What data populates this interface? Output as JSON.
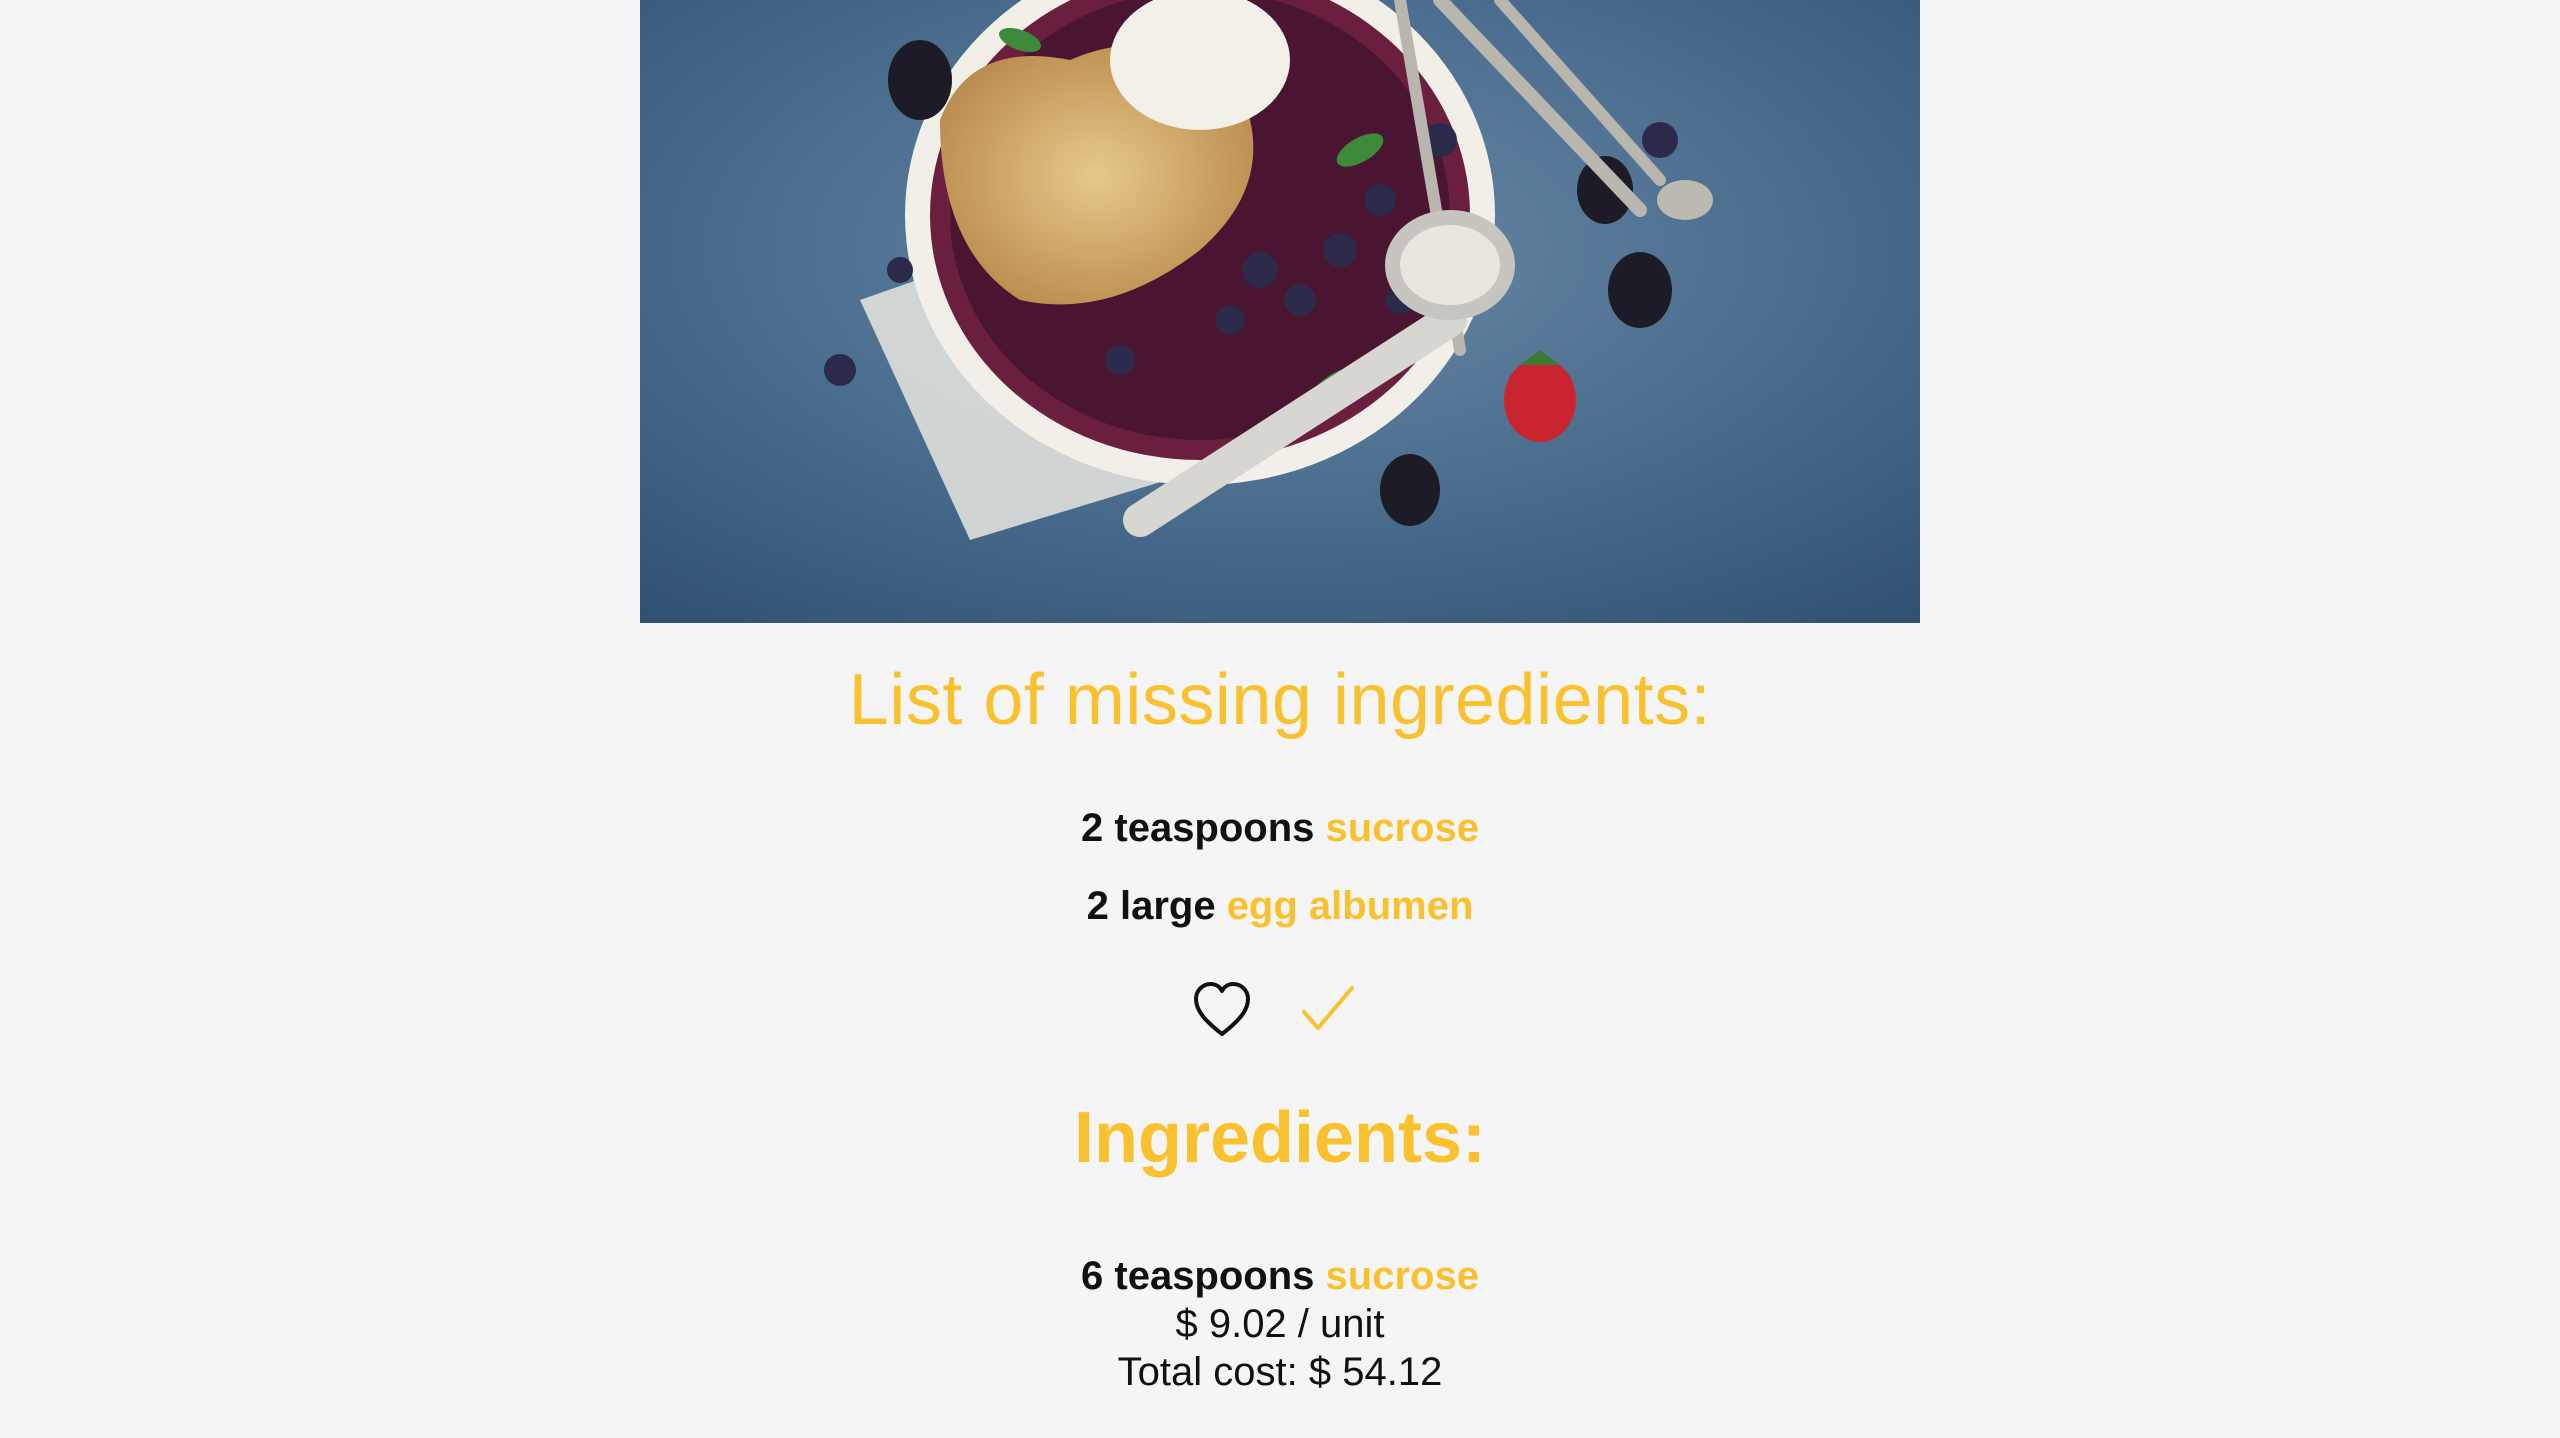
{
  "missing": {
    "title": "List of missing ingredients:",
    "items": [
      {
        "quantity": "2 teaspoons",
        "name": "sucrose"
      },
      {
        "quantity": "2 large",
        "name": "egg albumen"
      }
    ]
  },
  "actions": {
    "favorite_icon": "heart-icon",
    "confirm_icon": "checkmark-icon"
  },
  "ingredients": {
    "title": "Ingredients:",
    "items": [
      {
        "quantity": "6 teaspoons",
        "name": "sucrose",
        "unit_price": "$ 9.02 / unit",
        "total_cost": "Total cost: $ 54.12"
      }
    ]
  },
  "colors": {
    "accent": "#f9c12e",
    "background": "#f5f5f5",
    "text": "#111111"
  }
}
